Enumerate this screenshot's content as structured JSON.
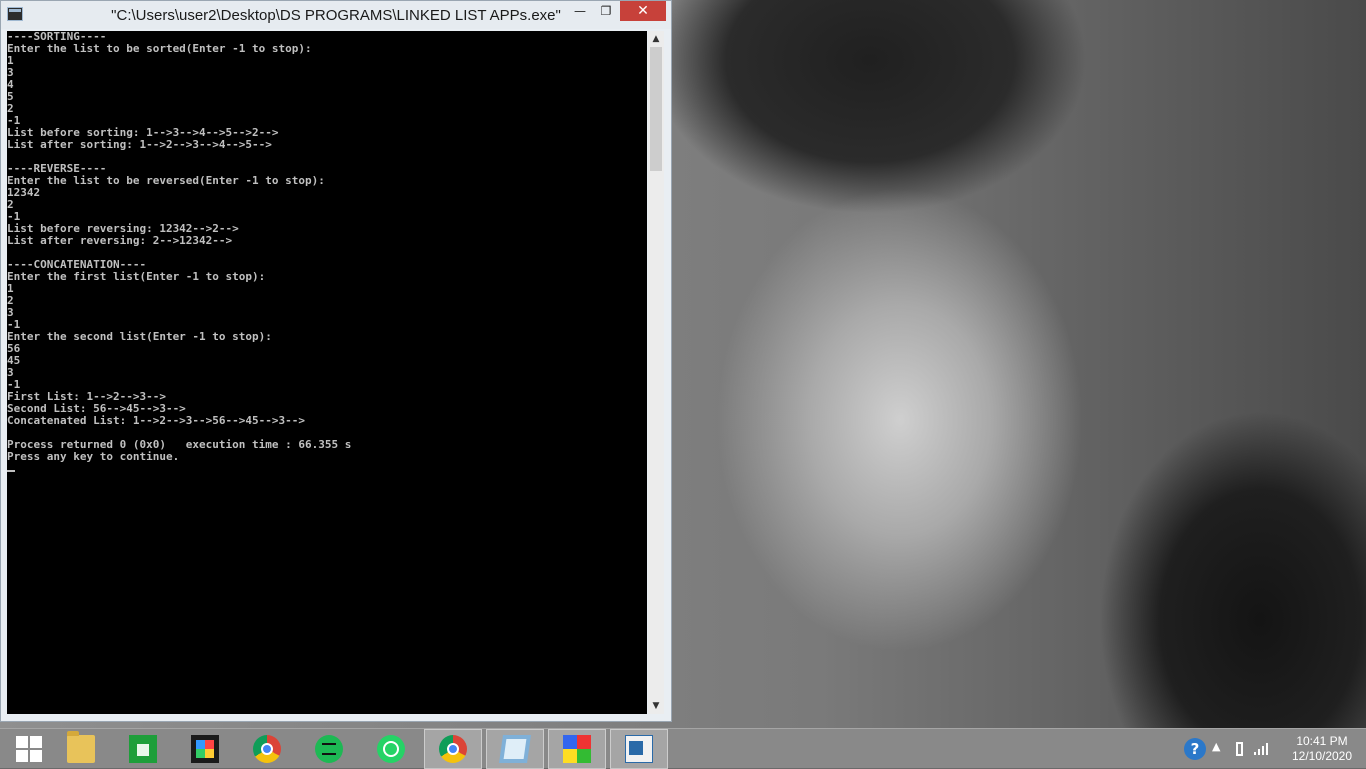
{
  "window": {
    "title": "\"C:\\Users\\user2\\Desktop\\DS PROGRAMS\\LINKED LIST APPs.exe\"",
    "minimize_glyph": "—",
    "maximize_glyph": "❐",
    "close_glyph": "✕"
  },
  "console": {
    "output": "----SORTING----\nEnter the list to be sorted(Enter -1 to stop):\n1\n3\n4\n5\n2\n-1\nList before sorting: 1-->3-->4-->5-->2-->\nList after sorting: 1-->2-->3-->4-->5-->\n\n----REVERSE----\nEnter the list to be reversed(Enter -1 to stop):\n12342\n2\n-1\nList before reversing: 12342-->2-->\nList after reversing: 2-->12342-->\n\n----CONCATENATION----\nEnter the first list(Enter -1 to stop):\n1\n2\n3\n-1\nEnter the second list(Enter -1 to stop):\n56\n45\n3\n-1\nFirst List: 1-->2-->3-->\nSecond List: 56-->45-->3-->\nConcatenated List: 1-->2-->3-->56-->45-->3-->\n\nProcess returned 0 (0x0)   execution time : 66.355 s\nPress any key to continue."
  },
  "taskbar": {
    "items": [
      {
        "name": "start",
        "icon": "windows-logo-icon"
      },
      {
        "name": "file-explorer",
        "icon": "folder-icon"
      },
      {
        "name": "store",
        "icon": "store-icon"
      },
      {
        "name": "photo-gallery",
        "icon": "gallery-icon"
      },
      {
        "name": "chrome",
        "icon": "chrome-icon"
      },
      {
        "name": "spotify",
        "icon": "spotify-icon"
      },
      {
        "name": "whatsapp",
        "icon": "whatsapp-icon"
      },
      {
        "name": "chrome-profile",
        "icon": "chrome-icon"
      },
      {
        "name": "notepad",
        "icon": "notepad-icon"
      },
      {
        "name": "colors-app",
        "icon": "colors-icon"
      },
      {
        "name": "console-app",
        "icon": "console-icon"
      }
    ],
    "tray": {
      "help_glyph": "?",
      "chevron_glyph": "▲",
      "time": "10:41 PM",
      "date": "12/10/2020"
    }
  },
  "colors": {
    "close_button": "#c7413a",
    "console_background": "#000000",
    "console_text": "#c0c0c0"
  }
}
